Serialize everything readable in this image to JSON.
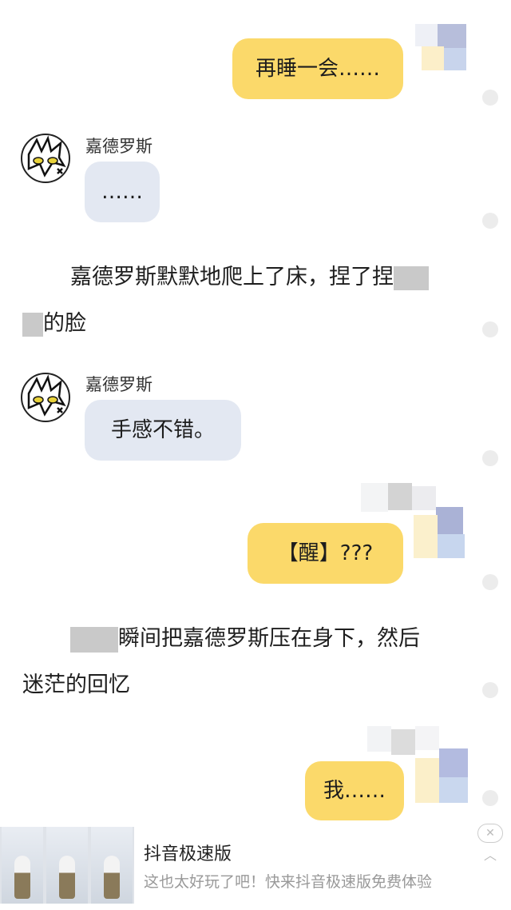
{
  "messages": [
    {
      "type": "user",
      "text": "再睡一会……"
    },
    {
      "type": "bot",
      "name": "嘉德罗斯",
      "text": "……"
    },
    {
      "type": "narration",
      "text_a": "嘉德罗斯默默地爬上了床，捏了捏",
      "text_b": "的脸"
    },
    {
      "type": "bot",
      "name": "嘉德罗斯",
      "text": "手感不错。"
    },
    {
      "type": "user",
      "text": "【醒】???"
    },
    {
      "type": "narration",
      "text_a": "瞬间把嘉德罗斯压在身下，然后",
      "text_b": "迷茫的回忆"
    },
    {
      "type": "user",
      "text": "我……"
    }
  ],
  "ad": {
    "title": "抖音极速版",
    "description": "这也太好玩了吧！快来抖音极速版免费体验",
    "close_icon": "close-icon",
    "expand_icon": "chevron-up-icon"
  },
  "colors": {
    "user_bubble": "#fbd96a",
    "bot_bubble": "#e3e8f2"
  }
}
